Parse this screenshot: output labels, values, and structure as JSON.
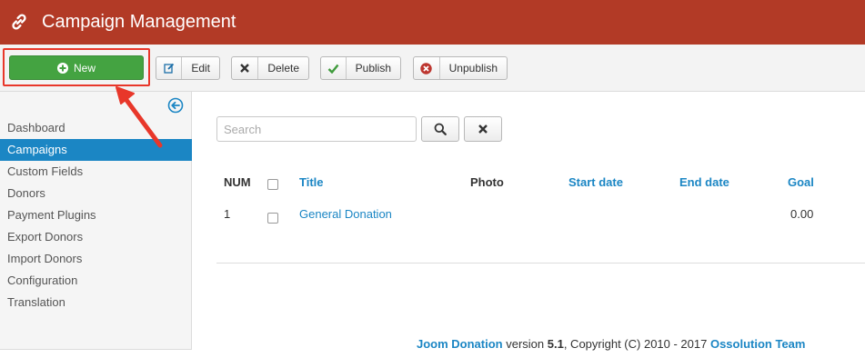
{
  "header": {
    "title": "Campaign Management",
    "icon": "link-icon",
    "bg_color": "#b23a26"
  },
  "toolbar": {
    "new_label": "New",
    "edit_label": "Edit",
    "delete_label": "Delete",
    "publish_label": "Publish",
    "unpublish_label": "Unpublish"
  },
  "sidebar": {
    "items": [
      {
        "label": "Dashboard"
      },
      {
        "label": "Campaigns"
      },
      {
        "label": "Custom Fields"
      },
      {
        "label": "Donors"
      },
      {
        "label": "Payment Plugins"
      },
      {
        "label": "Export Donors"
      },
      {
        "label": "Import Donors"
      },
      {
        "label": "Configuration"
      },
      {
        "label": "Translation"
      }
    ],
    "active_index": 1,
    "active_color": "#1b86c4"
  },
  "search": {
    "placeholder": "Search",
    "value": ""
  },
  "table": {
    "headers": {
      "num": "NUM",
      "title": "Title",
      "photo": "Photo",
      "start_date": "Start date",
      "end_date": "End date",
      "goal": "Goal"
    },
    "rows": [
      {
        "num": "1",
        "title": "General Donation",
        "photo": "",
        "start_date": "",
        "end_date": "",
        "goal": "0.00"
      }
    ]
  },
  "footer": {
    "product": "Joom Donation",
    "version_prefix": " version ",
    "version": "5.1",
    "copyright": ", Copyright (C) 2010 - 2017 ",
    "company": "Ossolution Team"
  },
  "colors": {
    "accent": "#1b86c4",
    "new_button": "#44a341",
    "highlight": "#e8372a"
  }
}
